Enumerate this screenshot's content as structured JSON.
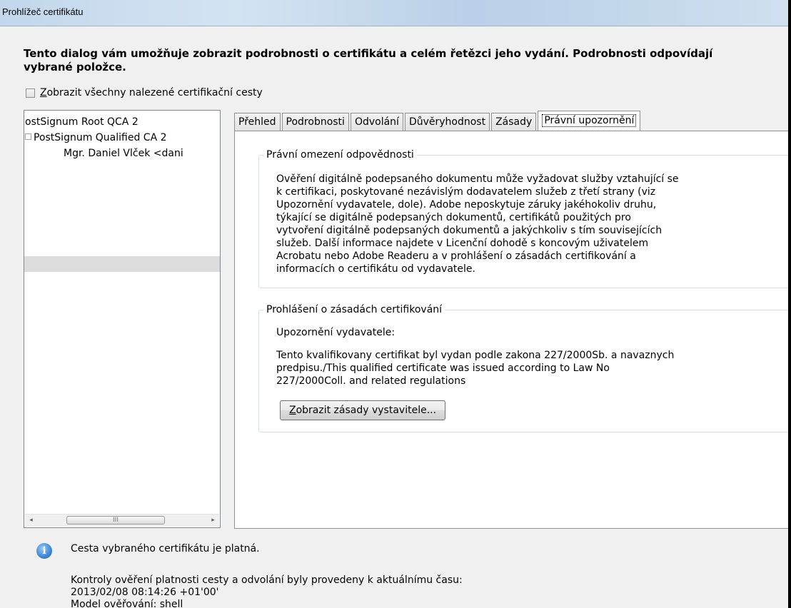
{
  "window": {
    "title": "Prohlížeč certifikátu"
  },
  "intro": {
    "line1": "Tento dialog vám umožňuje zobrazit podrobnosti o certifikátu a celém řetězci jeho vydání. Podrobnosti odpovídají",
    "line2": "vybrané položce."
  },
  "show_all_paths": {
    "accel": "Z",
    "label_rest": "obrazit všechny nalezené certifikační cesty",
    "checked": false
  },
  "tree": {
    "items": [
      {
        "label": "ostSignum Root QCA 2"
      },
      {
        "label": "PostSignum Qualified CA 2"
      },
      {
        "label": "Mgr. Daniel Vlček <dani"
      }
    ],
    "scrollbar": {
      "left_arrow": "◂",
      "thumb_grip": "III",
      "right_arrow": "▸"
    }
  },
  "tabs": [
    {
      "label": "Přehled"
    },
    {
      "label": "Podrobnosti"
    },
    {
      "label": "Odvolání"
    },
    {
      "label": "Důvěryhodnost"
    },
    {
      "label": "Zásady"
    },
    {
      "label": "Právní upozornění",
      "active": true
    }
  ],
  "legal": {
    "title": "Právní omezení odpovědnosti",
    "lines": [
      "Ověření digitálně podepsaného dokumentu může vyžadovat služby vztahující se",
      "k certifikaci, poskytované nezávislým dodavatelem služeb z třetí strany (viz",
      "Upozornění vydavatele, dole). Adobe neposkytuje záruky jakéhokoliv druhu,",
      "týkající se digitálně podepsaných dokumentů, certifikátů použitých pro",
      "vytvoření digitálně podepsaných dokumentů a jakýchkoliv s tím souvisejících",
      "služeb. Další informace najdete v Licenční dohodě s koncovým uživatelem",
      "Acrobatu nebo Adobe Readeru a v prohlášení o zásadách certifikování a",
      "informacích o certifikátu od vydavatele."
    ]
  },
  "policy": {
    "title": "Prohlášení o zásadách certifikování",
    "notice_label": "Upozornění vydavatele:",
    "notice_lines": [
      "Tento kvalifikovany certifikat byl vydan podle zakona 227/2000Sb. a navaznych",
      "predpisu./This qualified certificate was issued according to Law No",
      "227/2000Coll. and related regulations"
    ],
    "button_accel": "Z",
    "button_rest": "obrazit zásady vystavitele..."
  },
  "status": {
    "icon": "info-icon",
    "icon_glyph": "i",
    "message": "Cesta vybraného certifikátu je platná.",
    "details": [
      "Kontroly ověření platnosti cesty a odvolání byly provedeny k aktuálnímu času:",
      "2013/02/08 08:14:26 +01'00'",
      "Model ověřování: shell"
    ]
  }
}
